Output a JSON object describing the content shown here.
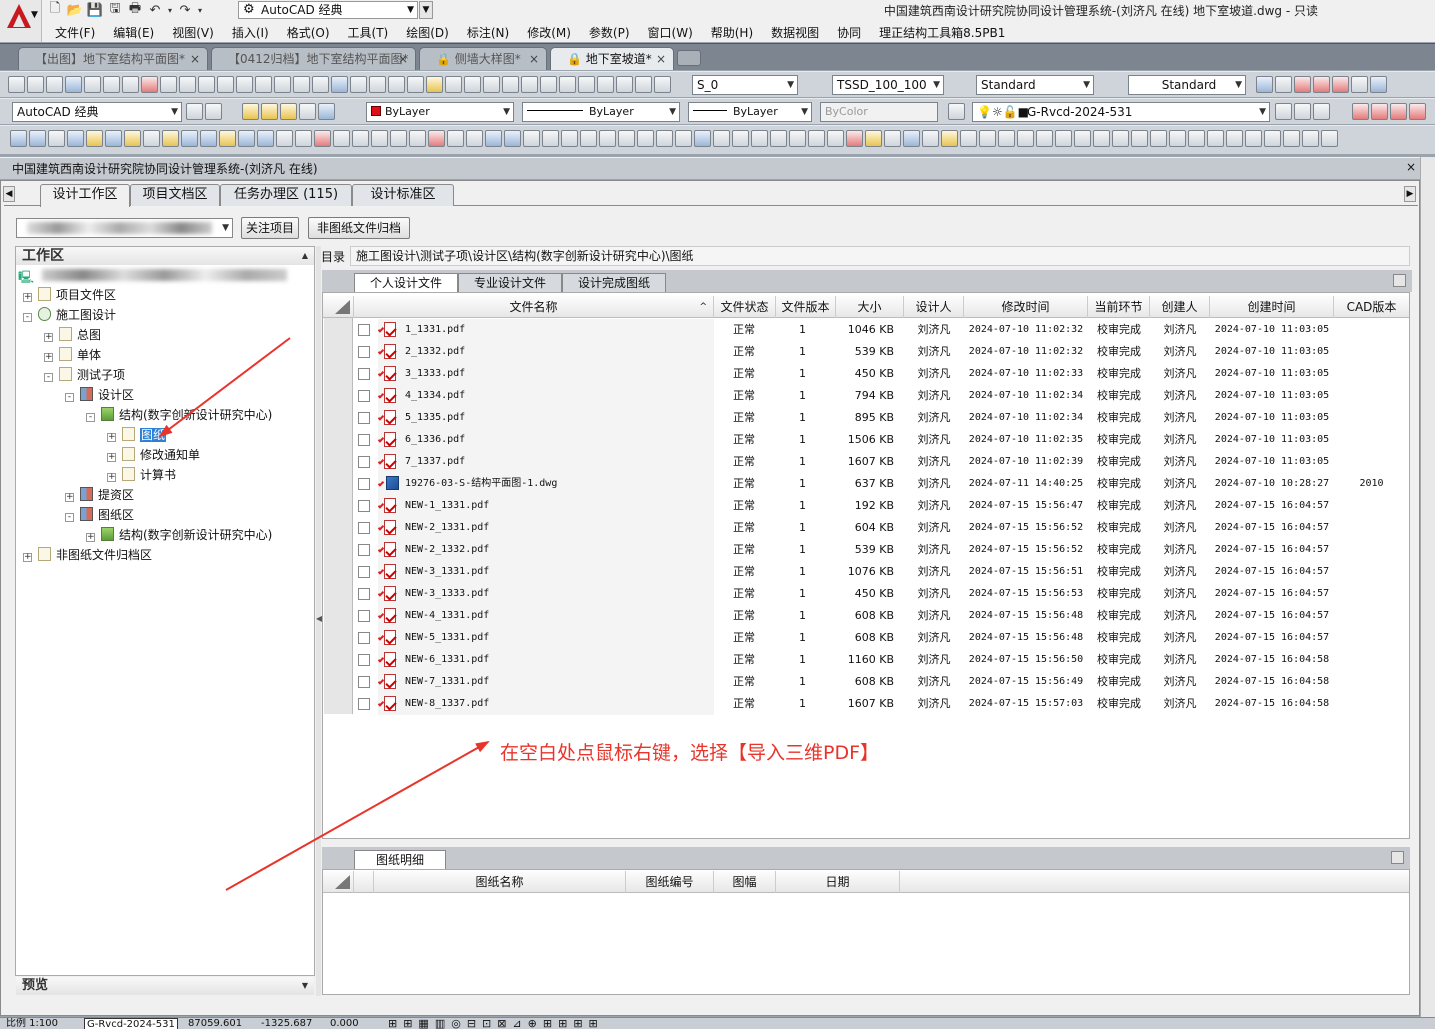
{
  "app": {
    "title": "中国建筑西南设计研究院协同设计管理系统-(刘济凡 在线)    地下室坡道.dwg - 只读",
    "workspace": "AutoCAD 经典"
  },
  "menu": [
    "文件(F)",
    "编辑(E)",
    "视图(V)",
    "插入(I)",
    "格式(O)",
    "工具(T)",
    "绘图(D)",
    "标注(N)",
    "修改(M)",
    "参数(P)",
    "窗口(W)",
    "帮助(H)",
    "数据视图",
    "协同",
    "理正结构工具箱8.5PB1"
  ],
  "doc_tabs": [
    {
      "label": "【出图】地下室结构平面图*"
    },
    {
      "label": "【0412归档】地下室结构平面图*"
    },
    {
      "label": "🔒 侧墙大样图*"
    },
    {
      "label": "🔒 地下室坡道*"
    }
  ],
  "toolbar": {
    "text_style": "S_0",
    "dim_style": "TSSD_100_100",
    "table_style": "Standard",
    "ml_style": "Standard",
    "workspace2": "AutoCAD 经典",
    "color": "ByLayer",
    "linetype": "ByLayer",
    "lineweight": "ByLayer",
    "plotstyle": "ByColor",
    "layer": "G-Rvcd-2024-531"
  },
  "panel": {
    "title": "中国建筑西南设计研究院协同设计管理系统-(刘济凡 在线)",
    "close": "×",
    "tabs": [
      {
        "label": "设计工作区"
      },
      {
        "label": "项目文档区"
      },
      {
        "label": "任务办理区 (115)"
      },
      {
        "label": "设计标准区"
      }
    ],
    "follow_btn": "关注项目",
    "archive_btn": "非图纸文件归档",
    "workarea_title": "工作区",
    "preview_title": "预览"
  },
  "tree": [
    {
      "label": "项目文件区",
      "pm": "+"
    },
    {
      "label": "施工图设计",
      "pm": "-"
    },
    {
      "label": "总图",
      "pm": "+"
    },
    {
      "label": "单体",
      "pm": "+"
    },
    {
      "label": "测试子项",
      "pm": "-"
    },
    {
      "label": "设计区",
      "pm": "-"
    },
    {
      "label": "结构(数字创新设计研究中心)",
      "pm": "-"
    },
    {
      "label": "图纸",
      "pm": "+"
    },
    {
      "label": "修改通知单",
      "pm": "+"
    },
    {
      "label": "计算书",
      "pm": "+"
    },
    {
      "label": "提资区",
      "pm": "+"
    },
    {
      "label": "图纸区",
      "pm": "-"
    },
    {
      "label": "结构(数字创新设计研究中心)",
      "pm": "+"
    },
    {
      "label": "非图纸文件归档区",
      "pm": "+"
    }
  ],
  "directory": {
    "label": "目录",
    "path": "施工图设计\\测试子项\\设计区\\结构(数字创新设计研究中心)\\图纸"
  },
  "file_tabs": [
    {
      "label": "个人设计文件"
    },
    {
      "label": "专业设计文件"
    },
    {
      "label": "设计完成图纸"
    }
  ],
  "columns": [
    "文件名称",
    "文件状态",
    "文件版本",
    "大小",
    "设计人",
    "修改时间",
    "当前环节",
    "创建人",
    "创建时间",
    "CAD版本"
  ],
  "files": [
    {
      "name": "1_1331.pdf",
      "type": "pdf",
      "status": "正常",
      "ver": "1",
      "size": "1046 KB",
      "designer": "刘济凡",
      "modified": "2024-07-10 11:02:32",
      "stage": "校审完成",
      "creator": "刘济凡",
      "created": "2024-07-10 11:03:05",
      "cad": ""
    },
    {
      "name": "2_1332.pdf",
      "type": "pdf",
      "status": "正常",
      "ver": "1",
      "size": "539 KB",
      "designer": "刘济凡",
      "modified": "2024-07-10 11:02:32",
      "stage": "校审完成",
      "creator": "刘济凡",
      "created": "2024-07-10 11:03:05",
      "cad": ""
    },
    {
      "name": "3_1333.pdf",
      "type": "pdf",
      "status": "正常",
      "ver": "1",
      "size": "450 KB",
      "designer": "刘济凡",
      "modified": "2024-07-10 11:02:33",
      "stage": "校审完成",
      "creator": "刘济凡",
      "created": "2024-07-10 11:03:05",
      "cad": ""
    },
    {
      "name": "4_1334.pdf",
      "type": "pdf",
      "status": "正常",
      "ver": "1",
      "size": "794 KB",
      "designer": "刘济凡",
      "modified": "2024-07-10 11:02:34",
      "stage": "校审完成",
      "creator": "刘济凡",
      "created": "2024-07-10 11:03:05",
      "cad": ""
    },
    {
      "name": "5_1335.pdf",
      "type": "pdf",
      "status": "正常",
      "ver": "1",
      "size": "895 KB",
      "designer": "刘济凡",
      "modified": "2024-07-10 11:02:34",
      "stage": "校审完成",
      "creator": "刘济凡",
      "created": "2024-07-10 11:03:05",
      "cad": ""
    },
    {
      "name": "6_1336.pdf",
      "type": "pdf",
      "status": "正常",
      "ver": "1",
      "size": "1506 KB",
      "designer": "刘济凡",
      "modified": "2024-07-10 11:02:35",
      "stage": "校审完成",
      "creator": "刘济凡",
      "created": "2024-07-10 11:03:05",
      "cad": ""
    },
    {
      "name": "7_1337.pdf",
      "type": "pdf",
      "status": "正常",
      "ver": "1",
      "size": "1607 KB",
      "designer": "刘济凡",
      "modified": "2024-07-10 11:02:39",
      "stage": "校审完成",
      "creator": "刘济凡",
      "created": "2024-07-10 11:03:05",
      "cad": ""
    },
    {
      "name": "19276-03-S-结构平面图-1.dwg",
      "type": "dwg",
      "status": "正常",
      "ver": "1",
      "size": "637 KB",
      "designer": "刘济凡",
      "modified": "2024-07-11 14:40:25",
      "stage": "校审完成",
      "creator": "刘济凡",
      "created": "2024-07-10 10:28:27",
      "cad": "2010"
    },
    {
      "name": "NEW-1_1331.pdf",
      "type": "pdf",
      "status": "正常",
      "ver": "1",
      "size": "192 KB",
      "designer": "刘济凡",
      "modified": "2024-07-15 15:56:47",
      "stage": "校审完成",
      "creator": "刘济凡",
      "created": "2024-07-15 16:04:57",
      "cad": ""
    },
    {
      "name": "NEW-2_1331.pdf",
      "type": "pdf",
      "status": "正常",
      "ver": "1",
      "size": "604 KB",
      "designer": "刘济凡",
      "modified": "2024-07-15 15:56:52",
      "stage": "校审完成",
      "creator": "刘济凡",
      "created": "2024-07-15 16:04:57",
      "cad": ""
    },
    {
      "name": "NEW-2_1332.pdf",
      "type": "pdf",
      "status": "正常",
      "ver": "1",
      "size": "539 KB",
      "designer": "刘济凡",
      "modified": "2024-07-15 15:56:52",
      "stage": "校审完成",
      "creator": "刘济凡",
      "created": "2024-07-15 16:04:57",
      "cad": ""
    },
    {
      "name": "NEW-3_1331.pdf",
      "type": "pdf",
      "status": "正常",
      "ver": "1",
      "size": "1076 KB",
      "designer": "刘济凡",
      "modified": "2024-07-15 15:56:51",
      "stage": "校审完成",
      "creator": "刘济凡",
      "created": "2024-07-15 16:04:57",
      "cad": ""
    },
    {
      "name": "NEW-3_1333.pdf",
      "type": "pdf",
      "status": "正常",
      "ver": "1",
      "size": "450 KB",
      "designer": "刘济凡",
      "modified": "2024-07-15 15:56:53",
      "stage": "校审完成",
      "creator": "刘济凡",
      "created": "2024-07-15 16:04:57",
      "cad": ""
    },
    {
      "name": "NEW-4_1331.pdf",
      "type": "pdf",
      "status": "正常",
      "ver": "1",
      "size": "608 KB",
      "designer": "刘济凡",
      "modified": "2024-07-15 15:56:48",
      "stage": "校审完成",
      "creator": "刘济凡",
      "created": "2024-07-15 16:04:57",
      "cad": ""
    },
    {
      "name": "NEW-5_1331.pdf",
      "type": "pdf",
      "status": "正常",
      "ver": "1",
      "size": "608 KB",
      "designer": "刘济凡",
      "modified": "2024-07-15 15:56:48",
      "stage": "校审完成",
      "creator": "刘济凡",
      "created": "2024-07-15 16:04:57",
      "cad": ""
    },
    {
      "name": "NEW-6_1331.pdf",
      "type": "pdf",
      "status": "正常",
      "ver": "1",
      "size": "1160 KB",
      "designer": "刘济凡",
      "modified": "2024-07-15 15:56:50",
      "stage": "校审完成",
      "creator": "刘济凡",
      "created": "2024-07-15 16:04:58",
      "cad": ""
    },
    {
      "name": "NEW-7_1331.pdf",
      "type": "pdf",
      "status": "正常",
      "ver": "1",
      "size": "608 KB",
      "designer": "刘济凡",
      "modified": "2024-07-15 15:56:49",
      "stage": "校审完成",
      "creator": "刘济凡",
      "created": "2024-07-15 16:04:58",
      "cad": ""
    },
    {
      "name": "NEW-8_1337.pdf",
      "type": "pdf",
      "status": "正常",
      "ver": "1",
      "size": "1607 KB",
      "designer": "刘济凡",
      "modified": "2024-07-15 15:57:03",
      "stage": "校审完成",
      "creator": "刘济凡",
      "created": "2024-07-15 16:04:58",
      "cad": ""
    }
  ],
  "annotation": "在空白处点鼠标右键，选择【导入三维PDF】",
  "detail": {
    "tab": "图纸明细",
    "columns": [
      "图纸名称",
      "图纸编号",
      "图幅",
      "日期"
    ]
  },
  "status": {
    "scale": "比例 1:100",
    "layer": "G-Rvcd-2024-531",
    "x": "87059.601",
    "y": "-1325.687",
    "z": "0.000"
  },
  "colors": {
    "accent": "#2e7fd6",
    "annotation": "#e8342a",
    "brand": "#c8191e"
  }
}
